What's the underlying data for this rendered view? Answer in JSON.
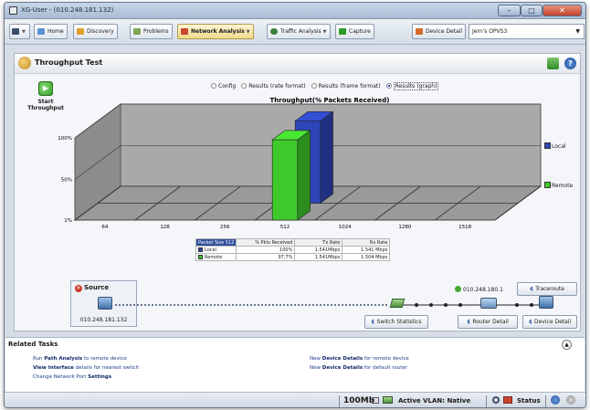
{
  "window": {
    "title": "XG-User - (010.248.181.132)"
  },
  "toolbar": {
    "menu_label": "",
    "home": "Home",
    "discovery": "Discovery",
    "problems": "Problems",
    "network_analysis": "Network Analysis",
    "traffic_analysis": "Traffic Analysis",
    "capture": "Capture",
    "device_detail": "Device Detail",
    "device_selected": "Jern's OPVS3"
  },
  "panel": {
    "title": "Throughput Test",
    "start_label_1": "Start",
    "start_label_2": "Throughput"
  },
  "view_options": [
    {
      "label": "Config",
      "selected": false
    },
    {
      "label": "Results (rate format)",
      "selected": false
    },
    {
      "label": "Results (frame format)",
      "selected": false
    },
    {
      "label": "Results (graph)",
      "selected": true
    }
  ],
  "chart_data": {
    "type": "bar",
    "title": "Throughput(% Packets Received)",
    "categories": [
      "64",
      "128",
      "256",
      "512",
      "1024",
      "1280",
      "1518"
    ],
    "y_ticks": [
      "100%",
      "50%",
      "1%"
    ],
    "ylim": [
      1,
      100
    ],
    "series": [
      {
        "name": "Local",
        "color": "#2e45b8",
        "values": [
          null,
          null,
          null,
          100,
          null,
          null,
          null
        ]
      },
      {
        "name": "Remote",
        "color": "#3fca2c",
        "values": [
          null,
          null,
          null,
          97.7,
          null,
          null,
          null
        ]
      }
    ],
    "legend_position": "right",
    "grid": true
  },
  "stats_table": {
    "headers": [
      "Packet Size 512",
      "% Pkts Received",
      "Tx Rate",
      "Rx Rate"
    ],
    "rows": [
      {
        "name": "Local",
        "color": "#2e45b8",
        "pct": "100%",
        "tx": "1.541Mbps",
        "rx": "1.541 Mbps"
      },
      {
        "name": "Remote",
        "color": "#3fca2c",
        "pct": "97.7%",
        "tx": "1.541Mbps",
        "rx": "1.504 Mbps"
      }
    ]
  },
  "path": {
    "source_label": "Source",
    "source_ip": "010.248.181.132",
    "dest_ip": "010.248.180.1",
    "traceroute": "Traceroute",
    "switch_statistics": "Switch Statistics",
    "router_detail": "Router Detail",
    "device_detail": "Device Detail"
  },
  "related": {
    "title": "Related Tasks",
    "tasks": [
      {
        "pre": "Run ",
        "bold": "Path Analysis",
        "post": " to remote device"
      },
      {
        "pre": "",
        "bold": "View Interface",
        "post": " details for nearest switch"
      },
      {
        "pre": "Change Network Port ",
        "bold": "Settings",
        "post": ""
      },
      {
        "pre": "New ",
        "bold": "Device Details",
        "post": " for remote device"
      },
      {
        "pre": "New ",
        "bold": "Device Details",
        "post": " for default router"
      }
    ]
  },
  "statusbar": {
    "speed": "100Mb",
    "vlan": "Active VLAN: Native",
    "status": "Status"
  }
}
